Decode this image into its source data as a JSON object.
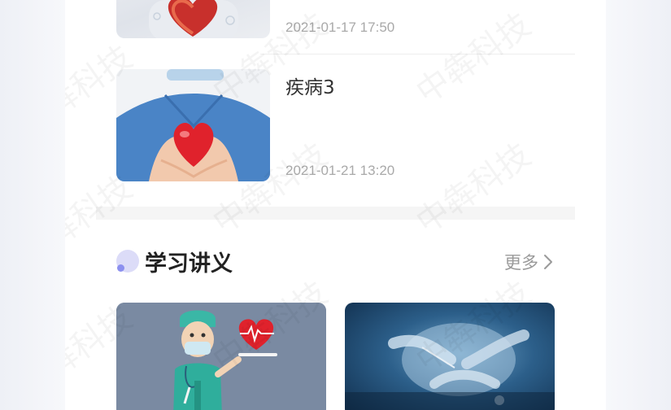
{
  "articles": [
    {
      "title": "",
      "date": "2021-01-17 17:50"
    },
    {
      "title": "疾病3",
      "date": "2021-01-21 13:20"
    }
  ],
  "section": {
    "title": "学习讲义",
    "more_label": "更多"
  },
  "watermark": "中犇科技",
  "colors": {
    "accent_dot": "#dcdcf8",
    "accent_dot_inner": "#8c90ef",
    "heart": "#e0222c"
  }
}
